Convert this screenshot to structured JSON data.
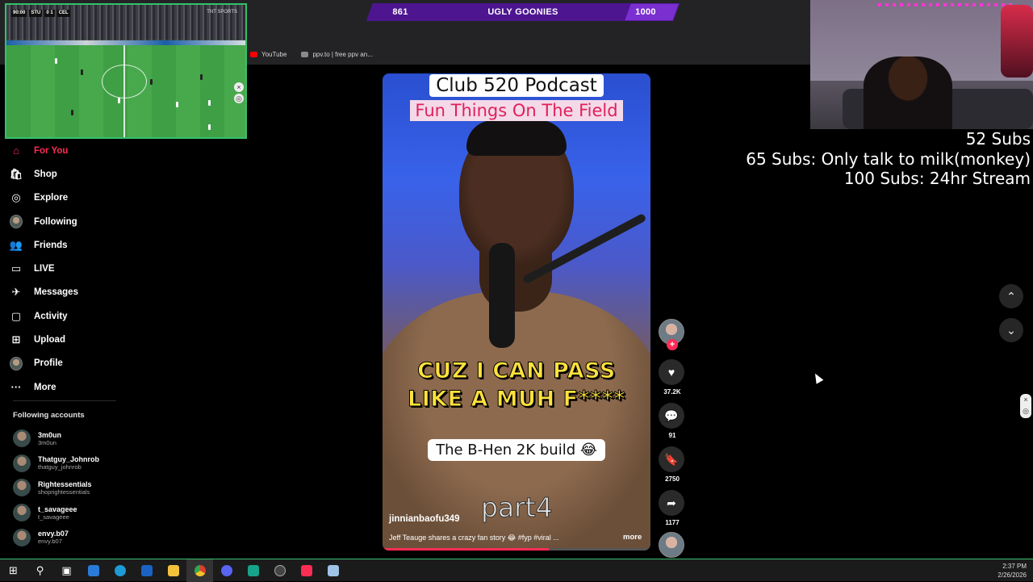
{
  "browser": {
    "bookmarks": [
      {
        "label": "YouTube",
        "icon": "youtube-icon",
        "color": "#ff0000"
      },
      {
        "label": "ppv.to | free ppv an...",
        "icon": "ppv-icon",
        "color": "#8a8a8a"
      }
    ]
  },
  "subbar": {
    "current": "861",
    "name": "UGLY GOONIES",
    "goal": "1000"
  },
  "soccer": {
    "score_home": "STU",
    "score": "0 1",
    "score_away": "CEL",
    "clock": "90:00",
    "broadcaster": "TNT SPORTS"
  },
  "nav": {
    "items": [
      {
        "label": "For You",
        "icon": "home-icon",
        "glyph": "⌂"
      },
      {
        "label": "Shop",
        "icon": "shop-icon",
        "glyph": "🛍"
      },
      {
        "label": "Explore",
        "icon": "compass-icon",
        "glyph": "◎"
      },
      {
        "label": "Following",
        "icon": "following-avatar-icon",
        "glyph": ""
      },
      {
        "label": "Friends",
        "icon": "friends-icon",
        "glyph": "👥"
      },
      {
        "label": "LIVE",
        "icon": "live-icon",
        "glyph": "▭"
      },
      {
        "label": "Messages",
        "icon": "messages-icon",
        "glyph": "✈"
      },
      {
        "label": "Activity",
        "icon": "activity-icon",
        "glyph": "▢"
      },
      {
        "label": "Upload",
        "icon": "upload-icon",
        "glyph": "⊞"
      },
      {
        "label": "Profile",
        "icon": "profile-avatar-icon",
        "glyph": ""
      },
      {
        "label": "More",
        "icon": "more-icon",
        "glyph": "···"
      }
    ],
    "following_title": "Following accounts",
    "accounts": [
      {
        "name": "3m0un",
        "handle": "3m0un"
      },
      {
        "name": "Thatguy_Johnrob",
        "handle": "thatguy_johnrob"
      },
      {
        "name": "Rightessentials",
        "handle": "shoprightessentials"
      },
      {
        "name": "t_savageee",
        "handle": "t_savageee"
      },
      {
        "name": "envy.b07",
        "handle": "envy.b07"
      }
    ]
  },
  "video": {
    "title_line1": "Club 520 Podcast",
    "title_line2": "Fun Things On The Field",
    "caption_line1": "CUZ I CAN PASS",
    "caption_line2": "LIKE A MUH F****",
    "build_label": "The B-Hen 2K build 😂",
    "part_label": "part4",
    "author": "jinnianbaofu349",
    "description": "Jeff Teauge shares a crazy fan story 😂 #fyp #viral ...",
    "more": "more",
    "progress": 0.62
  },
  "actions": {
    "likes": "37.2K",
    "comments": "91",
    "saves": "2750",
    "shares": "1177",
    "plus": "+"
  },
  "goals": {
    "line1": "52 Subs",
    "line2": "65 Subs: Only talk to milk(monkey)",
    "line3": "100 Subs: 24hr Stream"
  },
  "taskbar": {
    "time": "2:37 PM",
    "date": "2/26/2026"
  },
  "colors": {
    "accent": "#fe2c55",
    "overlay_border": "#35c06c",
    "subbar": "#7a2fd0"
  }
}
